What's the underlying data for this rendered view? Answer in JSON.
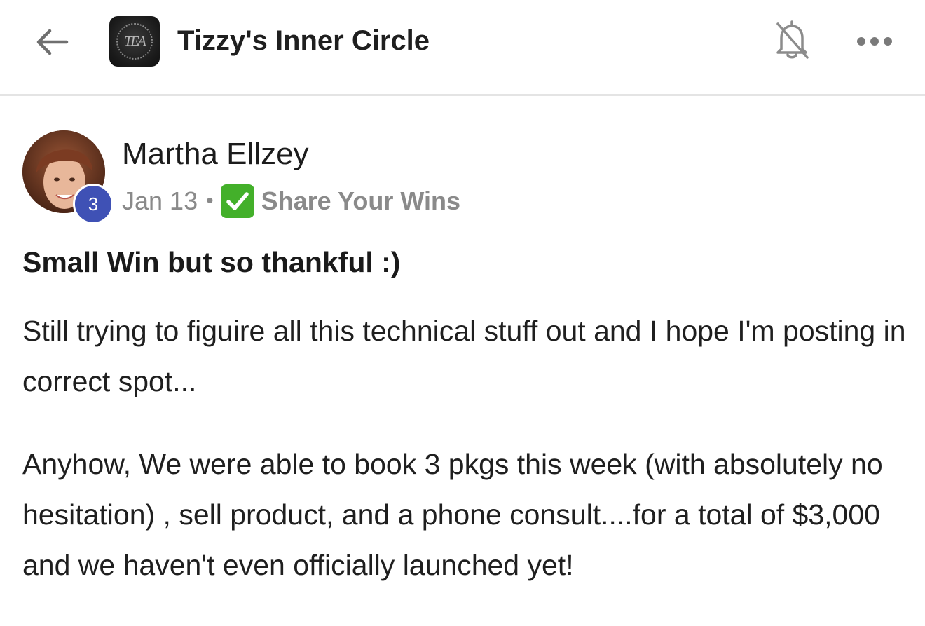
{
  "header": {
    "group_name": "Tizzy's Inner Circle",
    "group_logo_text": "TEA"
  },
  "post": {
    "author": "Martha Ellzey",
    "level": "3",
    "date": "Jan 13",
    "separator": "•",
    "category": "Share Your Wins",
    "category_emoji": "check-mark-button",
    "title": "Small Win but so thankful :)",
    "paragraphs": [
      "Still trying to figuire all this technical stuff out and I hope I'm posting in correct spot...",
      "Anyhow, We were able to book 3 pkgs this week (with absolutely no hesitation) , sell product, and a phone consult....for a total of $3,000 and we haven't even officially launched yet!"
    ]
  },
  "colors": {
    "badge": "#3f51b5",
    "category_emoji": "#43b02a",
    "muted_text": "#8a8a8a"
  }
}
